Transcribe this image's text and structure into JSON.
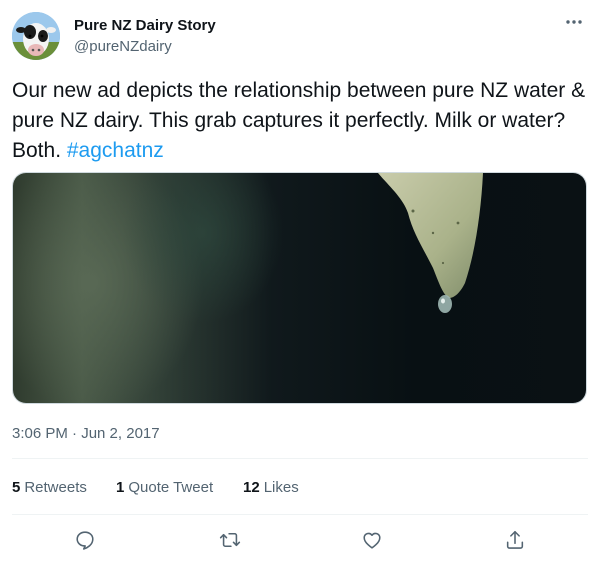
{
  "author": {
    "display_name": "Pure NZ Dairy Story",
    "handle": "@pureNZdairy",
    "avatar_icon": "cow-avatar"
  },
  "tweet": {
    "text": "Our new ad depicts the relationship between pure NZ water & pure NZ dairy. This grab captures it perfectly. Milk or water? Both. ",
    "hashtag": "#agchatnz",
    "timestamp": "3:06 PM · Jun 2, 2017"
  },
  "stats": {
    "retweets_count": "5",
    "retweets_label": "Retweets",
    "quotes_count": "1",
    "quotes_label": "Quote Tweet",
    "likes_count": "12",
    "likes_label": "Likes"
  },
  "actions": {
    "icons": [
      "reply-icon",
      "retweet-icon",
      "like-icon",
      "share-icon"
    ]
  },
  "colors": {
    "text": "#0f1419",
    "secondary": "#536471",
    "link": "#1d9bf0",
    "divider": "#eff3f4"
  }
}
